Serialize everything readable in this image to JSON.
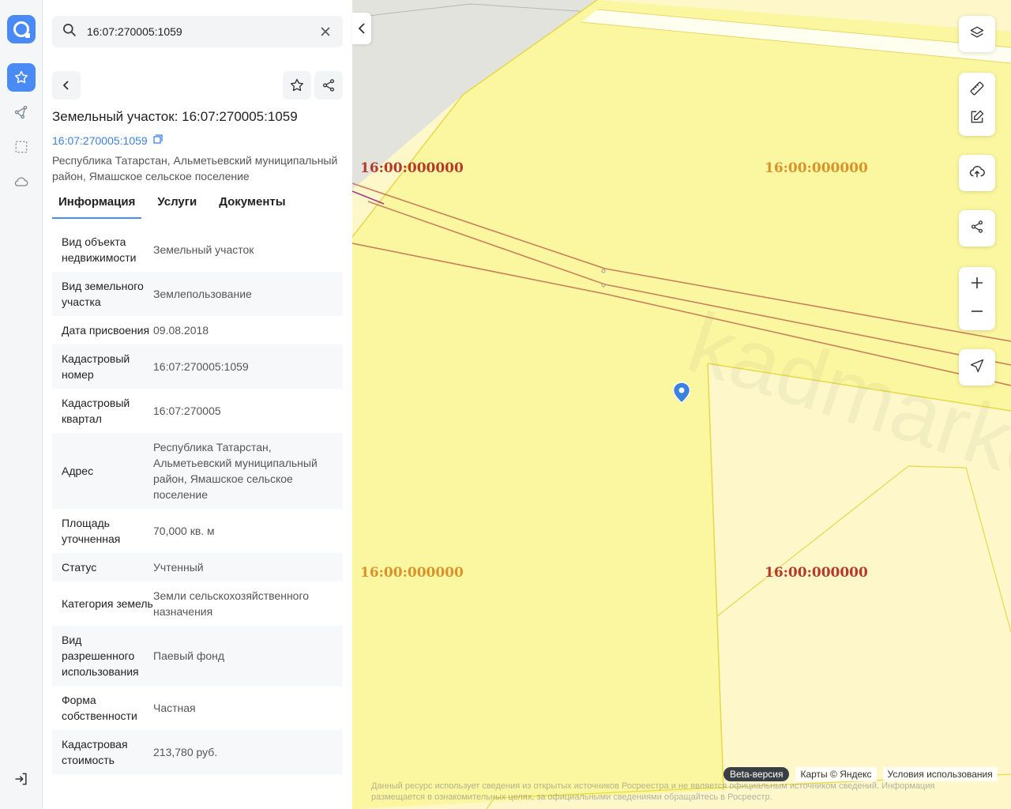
{
  "search": {
    "query": "16:07:270005:1059"
  },
  "object": {
    "title": "Земельный участок: 16:07:270005:1059",
    "cad_link": "16:07:270005:1059",
    "address": "Республика Татарстан, Альметьевский муниципальный район, Ямашское сельское поселение"
  },
  "tabs": [
    {
      "label": "Информация",
      "active": true
    },
    {
      "label": "Услуги"
    },
    {
      "label": "Документы"
    }
  ],
  "info": [
    {
      "k": "Вид объекта недвижимости",
      "v": "Земельный участок"
    },
    {
      "k": "Вид земельного участка",
      "v": "Землепользование"
    },
    {
      "k": "Дата присвоения",
      "v": "09.08.2018"
    },
    {
      "k": "Кадастровый номер",
      "v": "16:07:270005:1059"
    },
    {
      "k": "Кадастровый квартал",
      "v": "16:07:270005"
    },
    {
      "k": "Адрес",
      "v": "Республика Татарстан, Альметьевский муниципальный район, Ямашское сельское поселение"
    },
    {
      "k": "Площадь уточненная",
      "v": "70,000 кв. м"
    },
    {
      "k": "Статус",
      "v": "Учтенный"
    },
    {
      "k": "Категория земель",
      "v": "Земли сельскохозяйственного назначения"
    },
    {
      "k": "Вид разрешенного использования",
      "v": "Паевый фонд"
    },
    {
      "k": "Форма собственности",
      "v": "Частная"
    },
    {
      "k": "Кадастровая стоимость",
      "v": "213,780 руб."
    }
  ],
  "map": {
    "quarter_labels": [
      "16:00:000000",
      "16:00:000000",
      "16:00:000000",
      "16:00:000000"
    ],
    "watermark": "kadmarket.ru",
    "beta": "Beta-версия",
    "copyright": "Карты © Яндекс",
    "terms": "Условия использования",
    "disclaimer": "Данный ресурс использует сведения из открытых источников Росреестра и не является официальным источником сведений. Информация размещается в ознакомительных целях, за официальными сведениями обращайтесь в Росреестр."
  },
  "colors": {
    "accent": "#4a8af4",
    "parcel": "#fbf7a0",
    "parcel_light": "#fdf7c9",
    "boundary": "#c9805a"
  }
}
